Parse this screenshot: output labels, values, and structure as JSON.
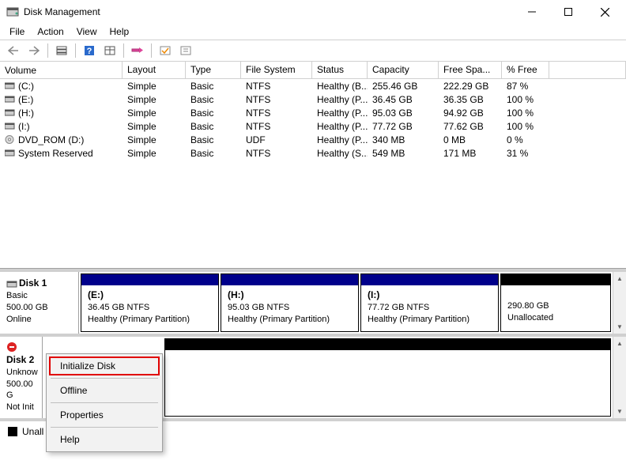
{
  "app": {
    "title": "Disk Management"
  },
  "menu": {
    "file": "File",
    "action": "Action",
    "view": "View",
    "help": "Help"
  },
  "columns": {
    "volume": "Volume",
    "layout": "Layout",
    "type": "Type",
    "filesystem": "File System",
    "status": "Status",
    "capacity": "Capacity",
    "freespace": "Free Spa...",
    "pctfree": "% Free"
  },
  "volumes": [
    {
      "name": "(C:)",
      "icon": "drive",
      "layout": "Simple",
      "type": "Basic",
      "fs": "NTFS",
      "status": "Healthy (B...",
      "capacity": "255.46 GB",
      "free": "222.29 GB",
      "pct": "87 %"
    },
    {
      "name": "(E:)",
      "icon": "drive",
      "layout": "Simple",
      "type": "Basic",
      "fs": "NTFS",
      "status": "Healthy (P...",
      "capacity": "36.45 GB",
      "free": "36.35 GB",
      "pct": "100 %"
    },
    {
      "name": "(H:)",
      "icon": "drive",
      "layout": "Simple",
      "type": "Basic",
      "fs": "NTFS",
      "status": "Healthy (P...",
      "capacity": "95.03 GB",
      "free": "94.92 GB",
      "pct": "100 %"
    },
    {
      "name": "(I:)",
      "icon": "drive",
      "layout": "Simple",
      "type": "Basic",
      "fs": "NTFS",
      "status": "Healthy (P...",
      "capacity": "77.72 GB",
      "free": "77.62 GB",
      "pct": "100 %"
    },
    {
      "name": "DVD_ROM (D:)",
      "icon": "dvd",
      "layout": "Simple",
      "type": "Basic",
      "fs": "UDF",
      "status": "Healthy (P...",
      "capacity": "340 MB",
      "free": "0 MB",
      "pct": "0 %"
    },
    {
      "name": "System Reserved",
      "icon": "drive",
      "layout": "Simple",
      "type": "Basic",
      "fs": "NTFS",
      "status": "Healthy (S...",
      "capacity": "549 MB",
      "free": "171 MB",
      "pct": "31 %"
    }
  ],
  "disk1": {
    "header": "Disk 1",
    "type": "Basic",
    "size": "500.00 GB",
    "state": "Online",
    "parts": [
      {
        "title": "(E:)",
        "line2": "36.45 GB NTFS",
        "line3": "Healthy (Primary Partition)",
        "bar": "blue"
      },
      {
        "title": "(H:)",
        "line2": "95.03 GB NTFS",
        "line3": "Healthy (Primary Partition)",
        "bar": "blue"
      },
      {
        "title": "(I:)",
        "line2": "77.72 GB NTFS",
        "line3": "Healthy (Primary Partition)",
        "bar": "blue"
      },
      {
        "title": "",
        "line2": "290.80 GB",
        "line3": "Unallocated",
        "bar": "black"
      }
    ]
  },
  "disk2": {
    "header": "Disk 2",
    "type": "Unknow",
    "size": "500.00 G",
    "state": "Not Init"
  },
  "legend": {
    "unallocated": "Unall"
  },
  "context_menu": {
    "initialize": "Initialize Disk",
    "offline": "Offline",
    "properties": "Properties",
    "help": "Help"
  }
}
